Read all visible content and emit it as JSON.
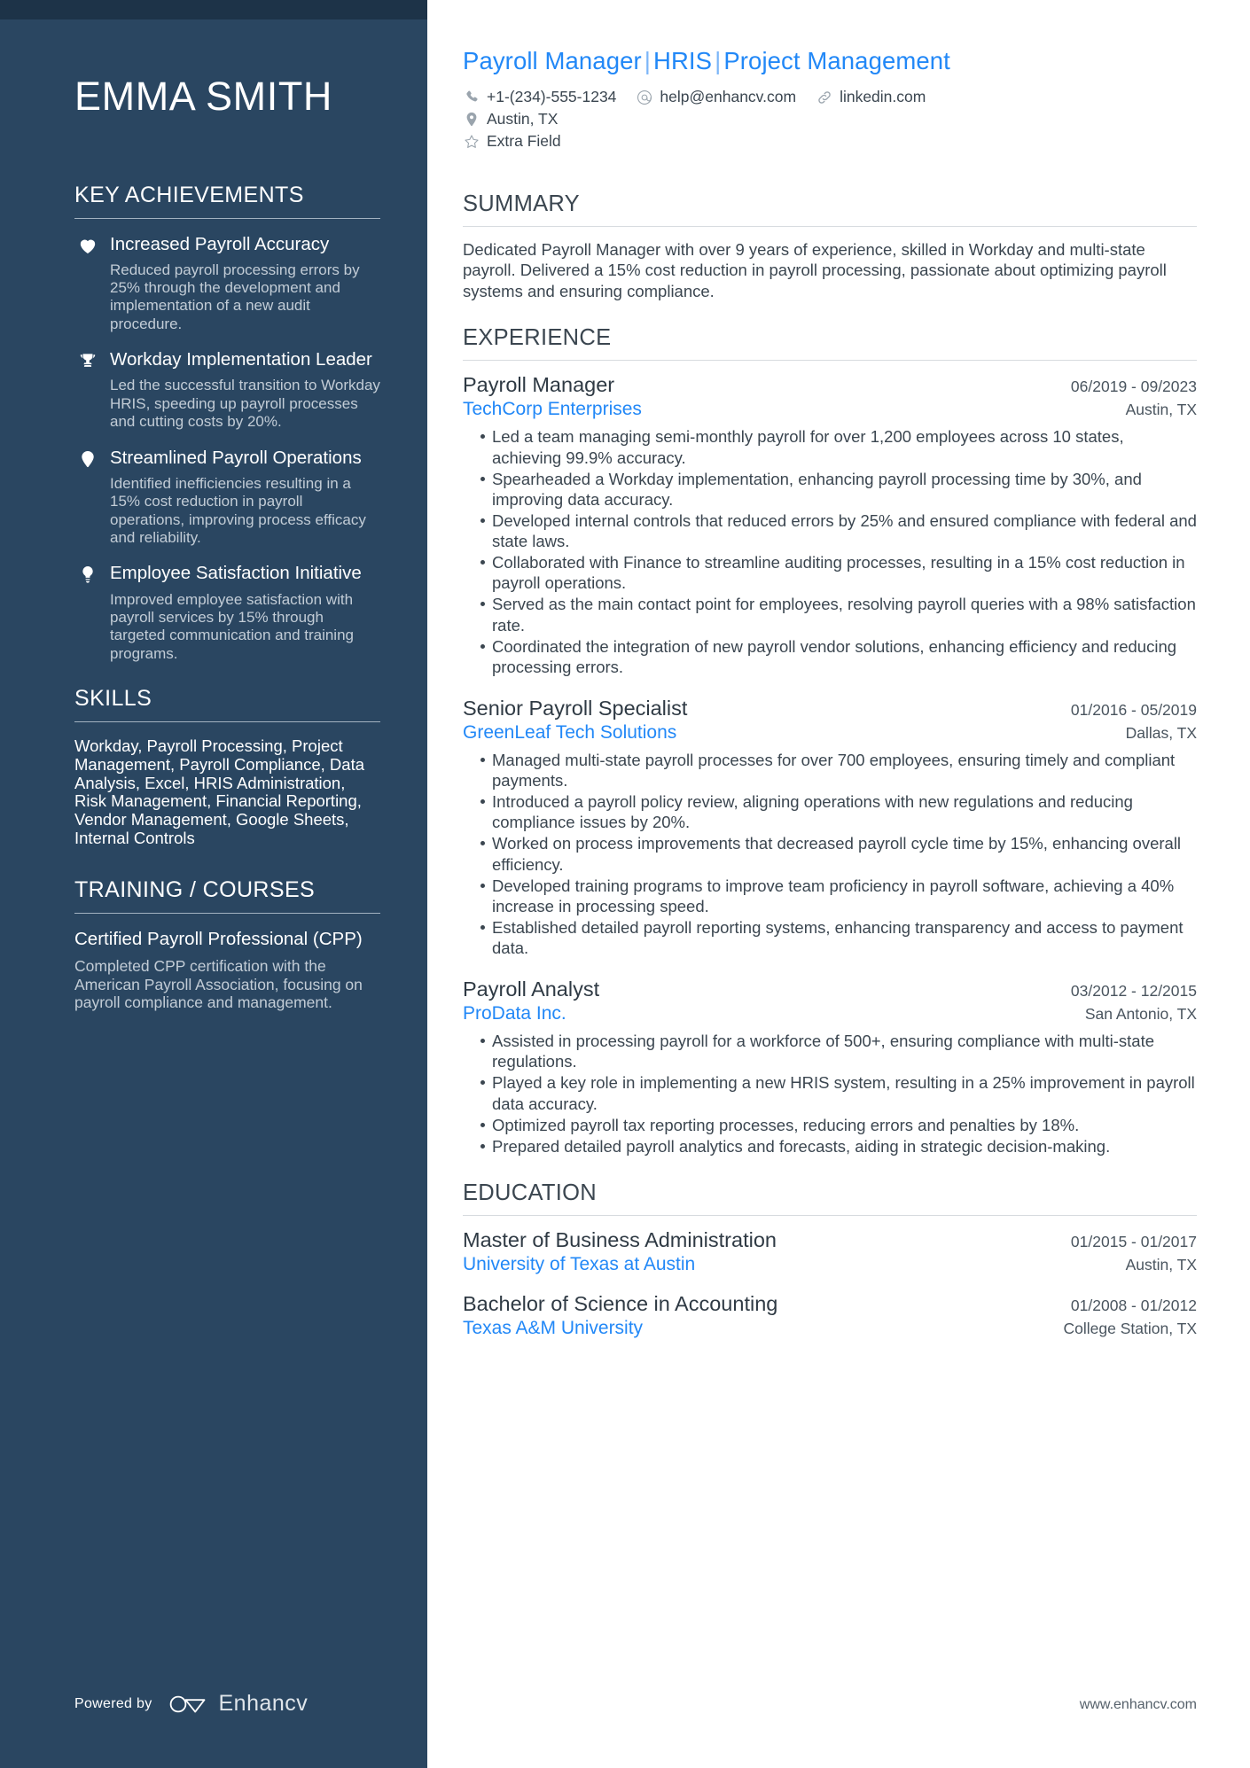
{
  "colors": {
    "sidebar_bg": "#2a4661",
    "sidebar_topbar": "#1d3348",
    "accent_blue": "#2288f7",
    "body_text": "#3b4650",
    "muted_text": "#c2ccd6"
  },
  "sidebar": {
    "name": "EMMA SMITH",
    "sections": {
      "key_achievements": {
        "heading": "KEY ACHIEVEMENTS",
        "items": [
          {
            "icon": "heart-icon",
            "title": "Increased Payroll Accuracy",
            "description": "Reduced payroll processing errors by 25% through the development and implementation of a new audit procedure."
          },
          {
            "icon": "trophy-icon",
            "title": "Workday Implementation Leader",
            "description": "Led the successful transition to Workday HRIS, speeding up payroll processes and cutting costs by 20%."
          },
          {
            "icon": "map-pin-icon",
            "title": "Streamlined Payroll Operations",
            "description": "Identified inefficiencies resulting in a 15% cost reduction in payroll operations, improving process efficacy and reliability."
          },
          {
            "icon": "lightbulb-icon",
            "title": "Employee Satisfaction Initiative",
            "description": "Improved employee satisfaction with payroll services by 15% through targeted communication and training programs."
          }
        ]
      },
      "skills": {
        "heading": "SKILLS",
        "text": "Workday, Payroll Processing, Project Management, Payroll Compliance, Data Analysis, Excel, HRIS Administration, Risk Management, Financial Reporting, Vendor Management, Google Sheets, Internal Controls"
      },
      "training": {
        "heading": "TRAINING / COURSES",
        "items": [
          {
            "title": "Certified Payroll Professional (CPP)",
            "description": "Completed CPP certification with the American Payroll Association, focusing on payroll compliance and management."
          }
        ]
      }
    },
    "footer": {
      "powered_by": "Powered by",
      "brand": "Enhancv"
    }
  },
  "main": {
    "headline": {
      "parts": [
        "Payroll Manager",
        "HRIS",
        "Project Management"
      ],
      "separator": "|"
    },
    "contacts": [
      {
        "icon": "phone-icon",
        "value": "+1-(234)-555-1234"
      },
      {
        "icon": "at-icon",
        "value": "help@enhancv.com"
      },
      {
        "icon": "link-icon",
        "value": "linkedin.com"
      },
      {
        "icon": "location-pin-icon",
        "value": "Austin, TX"
      },
      {
        "icon": "star-icon",
        "value": "Extra Field"
      }
    ],
    "summary": {
      "heading": "SUMMARY",
      "text": "Dedicated Payroll Manager with over 9 years of experience, skilled in Workday and multi-state payroll. Delivered a 15% cost reduction in payroll processing, passionate about optimizing payroll systems and ensuring compliance."
    },
    "experience": {
      "heading": "EXPERIENCE",
      "jobs": [
        {
          "title": "Payroll Manager",
          "dates": "06/2019 - 09/2023",
          "company": "TechCorp Enterprises",
          "location": "Austin, TX",
          "bullets": [
            "Led a team managing semi-monthly payroll for over 1,200 employees across 10 states, achieving 99.9% accuracy.",
            "Spearheaded a Workday implementation, enhancing payroll processing time by 30%, and improving data accuracy.",
            "Developed internal controls that reduced errors by 25% and ensured compliance with federal and state laws.",
            "Collaborated with Finance to streamline auditing processes, resulting in a 15% cost reduction in payroll operations.",
            "Served as the main contact point for employees, resolving payroll queries with a 98% satisfaction rate.",
            "Coordinated the integration of new payroll vendor solutions, enhancing efficiency and reducing processing errors."
          ]
        },
        {
          "title": "Senior Payroll Specialist",
          "dates": "01/2016 - 05/2019",
          "company": "GreenLeaf Tech Solutions",
          "location": "Dallas, TX",
          "bullets": [
            "Managed multi-state payroll processes for over 700 employees, ensuring timely and compliant payments.",
            "Introduced a payroll policy review, aligning operations with new regulations and reducing compliance issues by 20%.",
            "Worked on process improvements that decreased payroll cycle time by 15%, enhancing overall efficiency.",
            "Developed training programs to improve team proficiency in payroll software, achieving a 40% increase in processing speed.",
            "Established detailed payroll reporting systems, enhancing transparency and access to payment data."
          ]
        },
        {
          "title": "Payroll Analyst",
          "dates": "03/2012 - 12/2015",
          "company": "ProData Inc.",
          "location": "San Antonio, TX",
          "bullets": [
            "Assisted in processing payroll for a workforce of 500+, ensuring compliance with multi-state regulations.",
            "Played a key role in implementing a new HRIS system, resulting in a 25% improvement in payroll data accuracy.",
            "Optimized payroll tax reporting processes, reducing errors and penalties by 18%.",
            "Prepared detailed payroll analytics and forecasts, aiding in strategic decision-making."
          ]
        }
      ]
    },
    "education": {
      "heading": "EDUCATION",
      "entries": [
        {
          "degree": "Master of Business Administration",
          "dates": "01/2015 - 01/2017",
          "school": "University of Texas at Austin",
          "location": "Austin, TX"
        },
        {
          "degree": "Bachelor of Science in Accounting",
          "dates": "01/2008 - 01/2012",
          "school": "Texas A&M University",
          "location": "College Station, TX"
        }
      ]
    },
    "footer": {
      "website": "www.enhancv.com"
    }
  }
}
